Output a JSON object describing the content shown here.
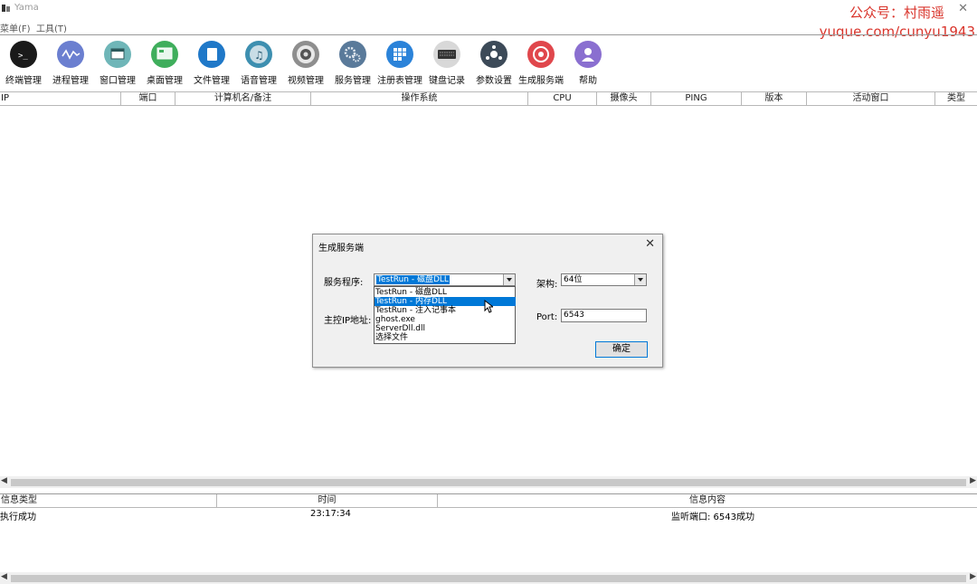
{
  "window": {
    "title": "Yama",
    "close_glyph": "✕"
  },
  "watermark": {
    "line1": "公众号：村雨遥",
    "line2": "yuque.com/cunyu1943"
  },
  "menu": [
    {
      "label": "菜单(F)"
    },
    {
      "label": "工具(T)"
    }
  ],
  "toolbar": [
    {
      "label": "终端管理",
      "icon": "terminal-icon",
      "color": "#1a1a1a"
    },
    {
      "label": "进程管理",
      "icon": "process-wave-icon",
      "color": "#6b7fd0"
    },
    {
      "label": "窗口管理",
      "icon": "window-icon",
      "color": "#6fb6b8"
    },
    {
      "label": "桌面管理",
      "icon": "desktop-icon",
      "color": "#3fae5c"
    },
    {
      "label": "文件管理",
      "icon": "file-icon",
      "color": "#1f78c8"
    },
    {
      "label": "语音管理",
      "icon": "music-note-icon",
      "color": "#3d8fb0"
    },
    {
      "label": "视频管理",
      "icon": "camera-icon",
      "color": "#8e8e8e"
    },
    {
      "label": "服务管理",
      "icon": "gears-icon",
      "color": "#5a7a9a"
    },
    {
      "label": "注册表管理",
      "icon": "registry-grid-icon",
      "color": "#2b83d9"
    },
    {
      "label": "键盘记录",
      "icon": "keyboard-icon",
      "color": "#d8d8d8"
    },
    {
      "label": "参数设置",
      "icon": "settings-nodes-icon",
      "color": "#3c4a58"
    },
    {
      "label": "生成服务端",
      "icon": "target-icon",
      "color": "#e0474c"
    },
    {
      "label": "帮助",
      "icon": "user-help-icon",
      "color": "#8a6fd0"
    }
  ],
  "client_list": {
    "columns": [
      "IP",
      "端口",
      "计算机名/备注",
      "操作系统",
      "CPU",
      "摄像头",
      "PING",
      "版本",
      "活动窗口",
      "类型"
    ]
  },
  "log": {
    "columns": [
      "信息类型",
      "时间",
      "信息内容"
    ],
    "rows": [
      {
        "type": "执行成功",
        "time": "23:17:34",
        "message": "监听端口: 6543成功"
      }
    ]
  },
  "dialog": {
    "title": "生成服务端",
    "service_label": "服务程序:",
    "service_value": "TestRun - 磁盘DLL",
    "service_options": [
      "TestRun - 磁盘DLL",
      "TestRun - 内存DLL",
      "TestRun - 注入记事本",
      "ghost.exe",
      "ServerDll.dll",
      "选择文件"
    ],
    "highlighted_option_index": 1,
    "arch_label": "架构:",
    "arch_value": "64位",
    "host_label": "主控IP地址:",
    "port_label": "Port:",
    "port_value": "6543",
    "ok_label": "确定"
  }
}
